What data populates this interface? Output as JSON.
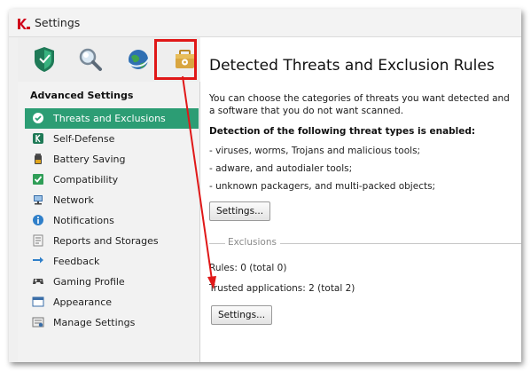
{
  "window": {
    "title": "Settings"
  },
  "toolbar": {
    "tools": [
      {
        "icon": "shield-icon"
      },
      {
        "icon": "magnifier-icon"
      },
      {
        "icon": "globe-icon"
      },
      {
        "icon": "briefcase-gear-icon"
      }
    ],
    "highlight_color": "#e01818"
  },
  "sidebar": {
    "header": "Advanced Settings",
    "items": [
      {
        "label": "Threats and Exclusions",
        "icon": "check-circle-icon",
        "active": true
      },
      {
        "label": "Self-Defense",
        "icon": "self-defense-shield-icon"
      },
      {
        "label": "Battery Saving",
        "icon": "battery-icon"
      },
      {
        "label": "Compatibility",
        "icon": "checkbox-icon"
      },
      {
        "label": "Network",
        "icon": "network-icon"
      },
      {
        "label": "Notifications",
        "icon": "info-icon"
      },
      {
        "label": "Reports and Storages",
        "icon": "report-icon"
      },
      {
        "label": "Feedback",
        "icon": "feedback-arrows-icon"
      },
      {
        "label": "Gaming Profile",
        "icon": "gamepad-icon"
      },
      {
        "label": "Appearance",
        "icon": "appearance-window-icon"
      },
      {
        "label": "Manage Settings",
        "icon": "manage-settings-icon"
      }
    ]
  },
  "content": {
    "title": "Detected Threats and Exclusion Rules",
    "intro": "You can choose the categories of threats you want detected and a software that you do not want scanned.",
    "detection_heading": "Detection of the following threat types is enabled:",
    "threats": [
      "- viruses, worms, Trojans and malicious tools;",
      "- adware, and autodialer tools;",
      "- unknown packagers, and multi-packed objects;"
    ],
    "settings_button_1": "Settings...",
    "exclusions_label": "Exclusions",
    "rules": "Rules: 0 (total 0)",
    "trusted": "Trusted applications: 2 (total 2)",
    "settings_button_2": "Settings..."
  },
  "colors": {
    "active_item": "#2c9d74",
    "annotation_red": "#e01818"
  }
}
